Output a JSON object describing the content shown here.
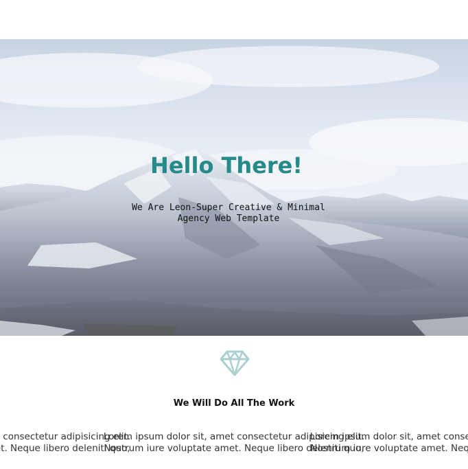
{
  "hero": {
    "title": "Hello There!",
    "subtitle_line1": "We Are Leon-Super Creative & Minimal",
    "subtitle_line2": "Agency Web Template",
    "background": "snowy-mountain-photo"
  },
  "feature": {
    "icon": "diamond-icon",
    "title": "We Will Do All The Work",
    "columns": [
      {
        "line1": "Lorem ipsum dolor sit, amet consectetur adipisicing elit.",
        "line2": "Nostrum iure voluptate amet. Neque libero deleniti quo,"
      },
      {
        "line1": "Lorem ipsum dolor sit, amet consectetur adipisicing elit.",
        "line2": "Nostrum iure voluptate amet. Neque libero deleniti quo,"
      },
      {
        "line1": "Lorem ipsum dolor sit, amet consectetur adipisicing elit.",
        "line2": "Nostrum iure voluptate amet. Neque libero deleniti quo,"
      }
    ]
  },
  "colors": {
    "accent": "#268a89",
    "icon": "#a9cfd0",
    "text": "#111111"
  }
}
